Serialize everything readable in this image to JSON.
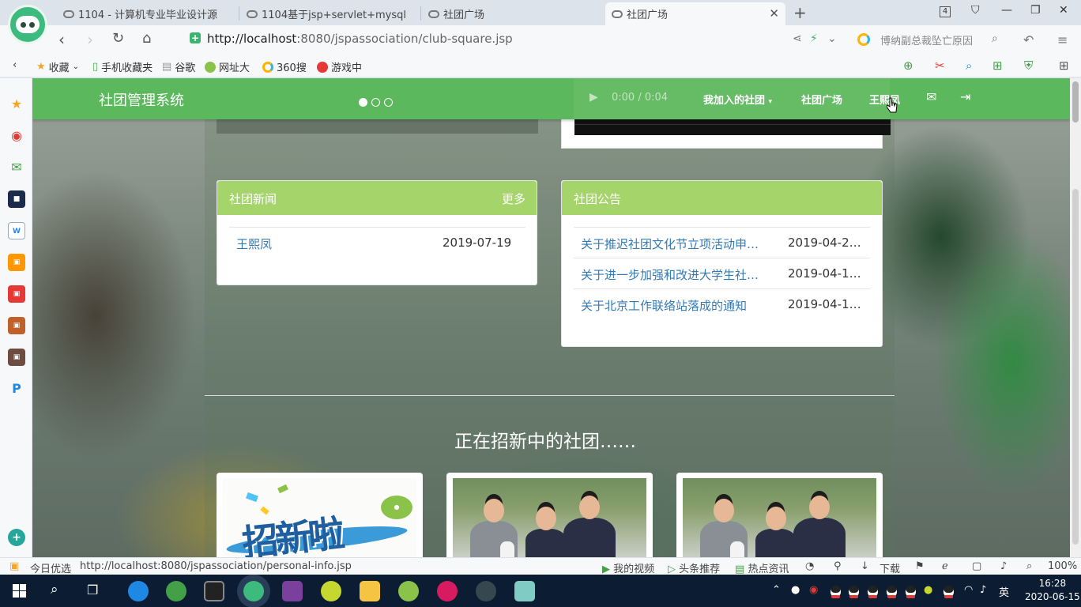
{
  "browser": {
    "tabs": [
      {
        "label": "1104 - 计算机专业毕业设计源",
        "active": false
      },
      {
        "label": "1104基于jsp+servlet+mysql",
        "active": false
      },
      {
        "label": "社团广场",
        "active": false
      },
      {
        "label": "社团广场",
        "active": true
      }
    ],
    "tab_count": "4",
    "url_host": "http://localhost",
    "url_rest": ":8080/jspassociation/club-square.jsp",
    "news_ticker": "博纳副总裁坠亡原因",
    "bookmarks": [
      "收藏",
      "手机收藏夹",
      "谷歌",
      "网址大",
      "360搜",
      "游戏中"
    ],
    "status_url": "http://localhost:8080/jspassociation/personal-info.jsp",
    "status_left": "今日优选",
    "status_items": [
      "我的视频",
      "头条推荐",
      "热点资讯",
      "下载"
    ],
    "zoom": "100%"
  },
  "site": {
    "brand": "社团管理系统",
    "audio_time": "0:00 / 0:04",
    "nav": {
      "my_clubs": "我加入的社团",
      "club_square": "社团广场",
      "user": "王熙凤"
    },
    "news_panel": {
      "title": "社团新闻",
      "more": "更多",
      "rows": [
        {
          "title": "王熙凤",
          "date": "2019-07-19"
        }
      ]
    },
    "notice_panel": {
      "title": "社团公告",
      "rows": [
        {
          "title": "关于推迟社团文化节立项活动申…",
          "date": "2019-04-2…"
        },
        {
          "title": "关于进一步加强和改进大学生社…",
          "date": "2019-04-1…"
        },
        {
          "title": "关于北京工作联络站落成的通知",
          "date": "2019-04-1…"
        }
      ]
    },
    "recruit_title": "正在招新中的社团……",
    "recruit_card_text": "招新啦"
  },
  "taskbar": {
    "clock_time": "16:28",
    "clock_date": "2020-06-15",
    "ime": "英"
  },
  "colors": {
    "nav_green": "#5cb85c",
    "panel_head": "#a5d46a",
    "link_blue": "#337ab7",
    "taskbar": "#0c1c33"
  }
}
